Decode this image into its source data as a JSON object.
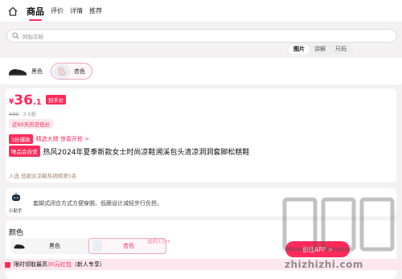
{
  "topbar": {
    "tabs": [
      {
        "label": "商品",
        "active": true
      },
      {
        "label": "评价",
        "active": false
      },
      {
        "label": "详情",
        "active": false
      },
      {
        "label": "推荐",
        "active": false
      }
    ]
  },
  "search": {
    "placeholder": "网脂凉鞋"
  },
  "media_tabs": [
    {
      "label": "图片",
      "active": true
    },
    {
      "label": "讲解",
      "active": false
    },
    {
      "label": "尺码",
      "active": false
    }
  ],
  "variant_strip": {
    "options": [
      {
        "label": "黑色",
        "selected": false
      },
      {
        "label": "杏色",
        "selected": true
      }
    ]
  },
  "price": {
    "currency": "¥",
    "integer": "36",
    "decimal": ".1",
    "tag": "到手价",
    "original": "¥99",
    "discount": "3.6折",
    "lowest_tag": "近60天历史低价"
  },
  "promo": {
    "badge": "3折爆款",
    "text": "精选大牌 惊喜开抢 >"
  },
  "product": {
    "member_badge": "唯品会自营",
    "title": "热风2024年夏季新款女士时尚凉鞋溯溪包头清凉洞洞套脚松糕鞋",
    "rank": "入选 低跟女凉鞋热销榜第5名"
  },
  "helper": {
    "label": "小助手",
    "text": "套脚式闭合方式方便穿脱、低跟设计减轻步行负担。"
  },
  "color_section": {
    "title": "颜色",
    "options": [
      {
        "label": "黑色",
        "selected": false
      },
      {
        "label": "杏色",
        "selected": true
      }
    ],
    "cart_hint": "加购1万+"
  },
  "bottom_bar": {
    "prefix": "限时领取最高",
    "highlight": "30元红包",
    "suffix": "（新人专享）"
  },
  "app_button": {
    "label": "前往APP >"
  },
  "watermark": {
    "text": "zhizhizhi.com"
  },
  "colors": {
    "accent": "#ff2a5a",
    "accent_light": "#fde7ee",
    "background": "#f4f1f3"
  }
}
